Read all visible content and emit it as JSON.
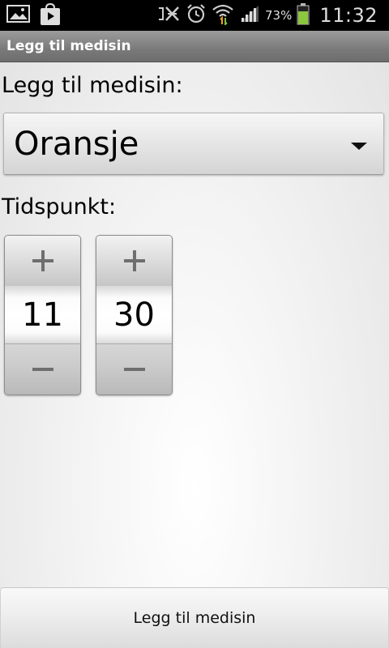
{
  "status_bar": {
    "icons_left": [
      "gallery-icon",
      "play-store-icon"
    ],
    "icons_right": [
      "nfc-muted-icon",
      "alarm-icon",
      "wifi-icon",
      "signal-icon",
      "battery-icon"
    ],
    "battery_percent": "73%",
    "battery_level": 0.73,
    "battery_color": "#8cc63f",
    "time": "11:32"
  },
  "title_bar": {
    "title": "Legg til medisin"
  },
  "form": {
    "medicine_label": "Legg til medisin:",
    "medicine_selected": "Oransje",
    "time_label": "Tidspunkt:",
    "hour": "11",
    "minute": "30"
  },
  "actions": {
    "add_button_label": "Legg til medisin"
  }
}
